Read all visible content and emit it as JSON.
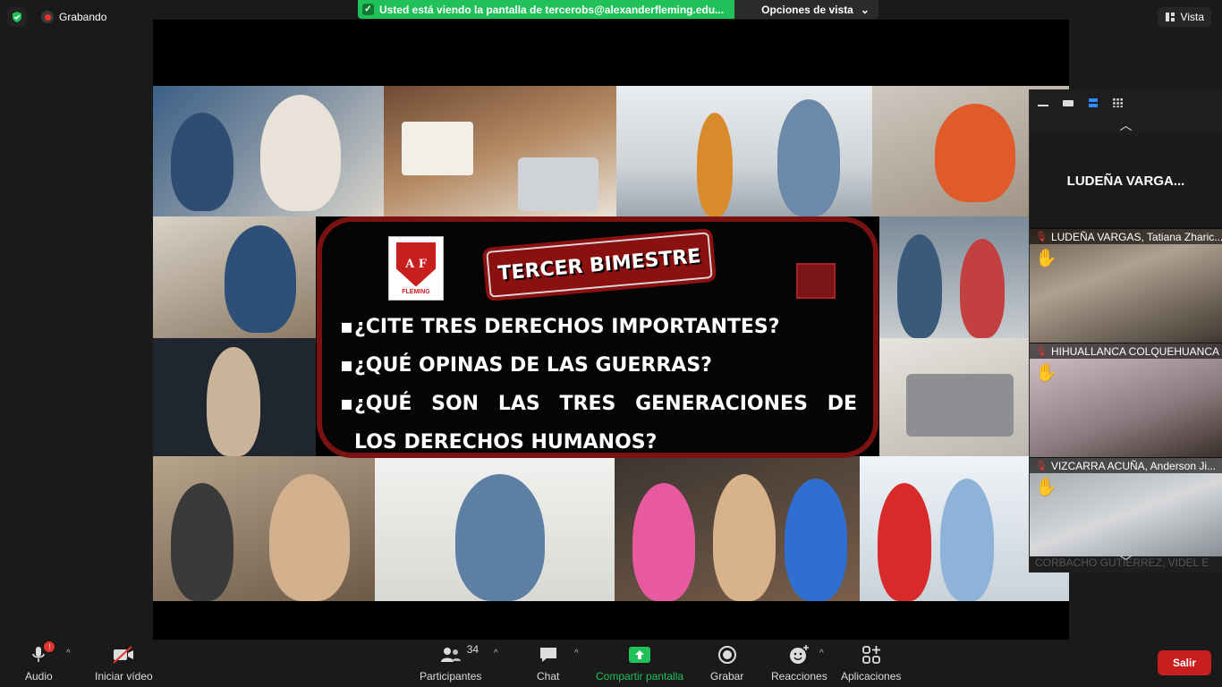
{
  "topbar": {
    "recording_label": "Grabando",
    "banner_text": "Usted está viendo la pantalla de tercerobs@alexanderfleming.edu...",
    "view_options": "Opciones de vista",
    "vista_label": "Vista"
  },
  "slide": {
    "badge": "TERCER BIMESTRE",
    "logo_letters": "A F",
    "logo_text": "FLEMING",
    "questions": [
      "¿CITE TRES DERECHOS IMPORTANTES?",
      "¿QUÉ OPINAS DE LAS GUERRAS?",
      "¿QUÉ SON LAS TRES GENERACIONES DE",
      "LOS DERECHOS HUMANOS?"
    ]
  },
  "panel": {
    "name_card": "LUDEÑA VARGA...",
    "participants": [
      "LUDEÑA VARGAS, Tatiana Zharic...",
      "HIHUALLANCA COLQUEHUANCA",
      "VIZCARRA ACUÑA, Anderson Ji...",
      "CORBACHO GUTIERREZ, VIDEL E"
    ]
  },
  "toolbar": {
    "audio": "Audio",
    "video": "Iniciar vídeo",
    "participants": "Participantes",
    "participants_count": "34",
    "chat": "Chat",
    "share": "Compartir pantalla",
    "record": "Grabar",
    "reactions": "Reacciones",
    "apps": "Aplicaciones",
    "leave": "Salir"
  }
}
